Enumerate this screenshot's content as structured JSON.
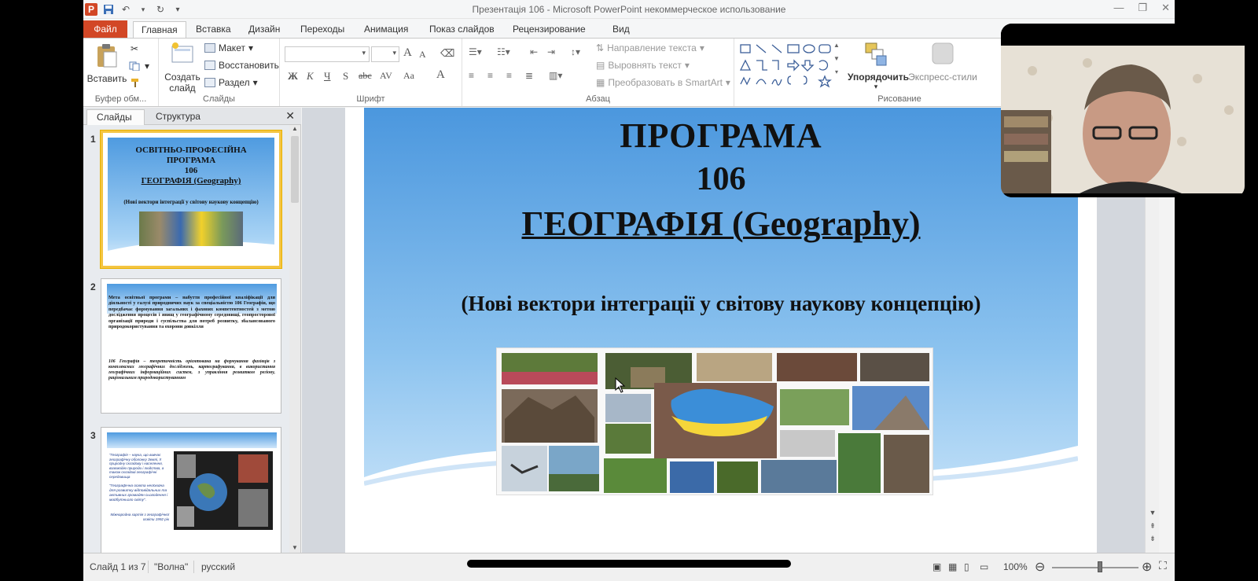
{
  "window": {
    "title": "Презентація 106  -  Microsoft PowerPoint некоммерческое использование",
    "app_icon_letter": "P"
  },
  "ribbon_tabs": [
    {
      "label": "Файл"
    },
    {
      "label": "Главная"
    },
    {
      "label": "Вставка"
    },
    {
      "label": "Дизайн"
    },
    {
      "label": "Переходы"
    },
    {
      "label": "Анимация"
    },
    {
      "label": "Показ слайдов"
    },
    {
      "label": "Рецензирование"
    },
    {
      "label": "Вид"
    }
  ],
  "ribbon": {
    "clipboard": {
      "paste": "Вставить",
      "group": "Буфер обм..."
    },
    "slides": {
      "new_slide_line1": "Создать",
      "new_slide_line2": "слайд",
      "layout": "Макет",
      "reset": "Восстановить",
      "section": "Раздел",
      "group": "Слайды"
    },
    "font": {
      "group": "Шрифт",
      "bold": "Ж",
      "italic": "К",
      "underline": "Ч",
      "shadow": "S",
      "strike": "abc",
      "spacing": "AV",
      "case": "Aa",
      "color": "A",
      "grow": "A",
      "shrink": "A"
    },
    "paragraph": {
      "group": "Абзац",
      "direction": "Направление текста",
      "align_text": "Выровнять текст",
      "smartart": "Преобразовать в SmartArt"
    },
    "drawing": {
      "group": "Рисование",
      "arrange": "Упорядочить",
      "quick_styles": "Экспресс-стили"
    }
  },
  "left_pane": {
    "tab_slides": "Слайды",
    "tab_outline": "Структура",
    "close": "✕",
    "thumbnails": [
      {
        "number": "1",
        "lines": [
          "ОСВІТНЬО-ПРОФЕСІЙНА",
          "ПРОГРАМА",
          "106",
          "ГЕОГРАФІЯ (Geography)"
        ],
        "sub": "(Нові вектори інтеграції у світову наукову концепцію)"
      },
      {
        "number": "2",
        "para1": "Мета освітньої програми – набуття професійної кваліфікації для діяльності у галузі природничих наук за спеціальністю 106 Географія, що передбачає формування загальних і фахових компетентностей з метою дослідження процесів і явищ у географічному середовищі, геопросторової організації природи і суспільства для потреб розвитку, збалансованого природокористування та охорони довкілля",
        "para2": "106 Географія – теоретичність орієнтована на формування фахівців з комплексних географічних досліджень, картографування, в використання географічних інформаційних систем, з управління розвитком регіону, раціональним природокористуванням"
      },
      {
        "number": "3",
        "para1": "\"Географія – наука, що вивчає географічну оболонку Землі, її природну складову і населення, взаємодію природи і людства, а також складові географічні середовища",
        "para2": "\"Географічна освіта необхідна для розвитку відповідальних та активних громадян сьогодення і майбутнього світу\".",
        "para3": "Міжнародна хартія з географічної освіти 1992 рік"
      }
    ]
  },
  "slide": {
    "title_line1": "ПРОГРАМА",
    "title_line2": "106",
    "title_line3": "ГЕОГРАФІЯ (Geography)",
    "subtitle": "(Нові вектори інтеграції у світову наукову концепцію)"
  },
  "status_bar": {
    "slide_info": "Слайд 1 из 7",
    "theme": "\"Волна\"",
    "language": "русский",
    "zoom": "100%"
  },
  "colors": {
    "accent_file_tab": "#d24726",
    "slide_sky": "#6aaee6",
    "selection_border": "#f4c542"
  }
}
